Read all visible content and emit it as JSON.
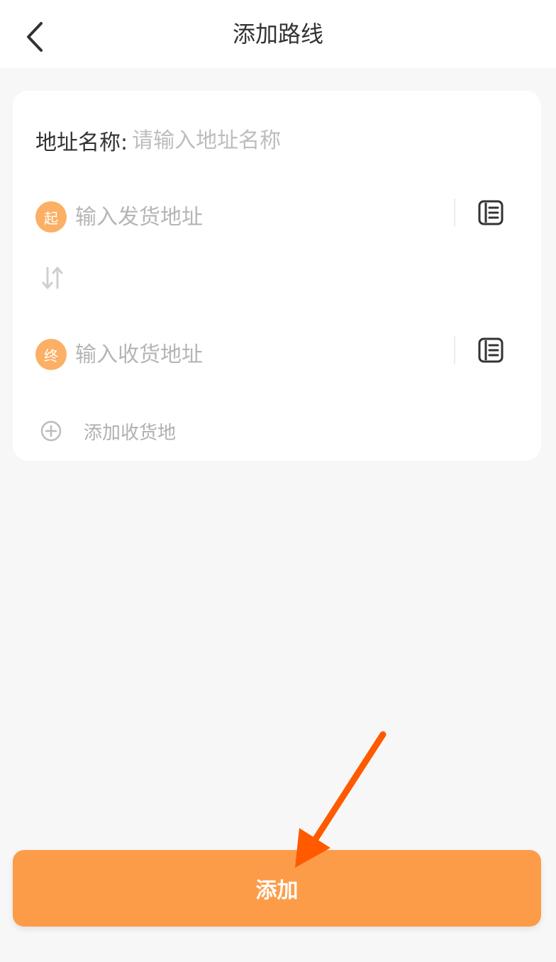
{
  "header": {
    "title": "添加路线",
    "back_icon": "chevron-left-icon"
  },
  "form": {
    "name_label": "地址名称:",
    "name_placeholder": "请输入地址名称",
    "start": {
      "badge": "起",
      "placeholder": "输入发货地址",
      "book_icon": "address-book-icon"
    },
    "swap_icon": "swap-vertical-icon",
    "end": {
      "badge": "终",
      "placeholder": "输入收货地址",
      "book_icon": "address-book-icon"
    },
    "add_destination": {
      "icon": "plus-circle-icon",
      "label": "添加收货地"
    }
  },
  "submit": {
    "label": "添加"
  },
  "colors": {
    "accent": "#fd9c48",
    "badge": "#fbb065",
    "annotation_arrow": "#ff5a00"
  }
}
